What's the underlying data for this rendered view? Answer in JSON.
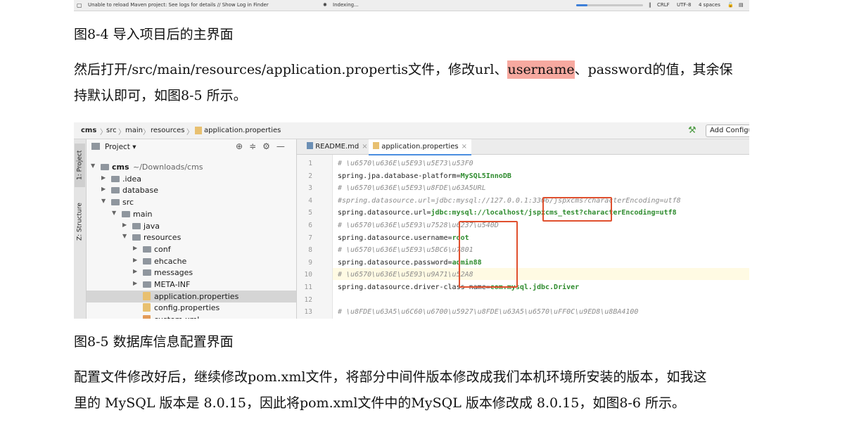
{
  "statusbar": {
    "message": "Unable to reload Maven project: See logs for details // Show Log in Finder",
    "indexing": "Indexing...",
    "progress": 0.17,
    "line_sep": "CRLF",
    "encoding": "UTF-8",
    "indent": "4 spaces"
  },
  "caption1": "图8-4 导入项目后的主界面",
  "para1": {
    "before": "然后打开/src/main/resources/application.propertis文件，修改url、",
    "highlight": "username",
    "after": "、password的值，其余保",
    "line2": "持默认即可，如图8-5 所示。",
    "highlight_color": "#f7a9a0"
  },
  "ide": {
    "breadcrumbs": [
      "cms",
      "src",
      "main",
      "resources",
      "application.properties"
    ],
    "add_config": "Add Configu",
    "side_tabs": [
      "1: Project",
      "Z: Structure"
    ],
    "project_header": "Project",
    "tree": [
      {
        "label": "cms",
        "sub": "~/Downloads/cms",
        "level": 0,
        "arrow": "▼",
        "kind": "folder",
        "bold": true
      },
      {
        "label": ".idea",
        "level": 1,
        "arrow": "▶",
        "kind": "folder"
      },
      {
        "label": "database",
        "level": 1,
        "arrow": "▶",
        "kind": "folder"
      },
      {
        "label": "src",
        "level": 1,
        "arrow": "▼",
        "kind": "folder"
      },
      {
        "label": "main",
        "level": 2,
        "arrow": "▼",
        "kind": "folder"
      },
      {
        "label": "java",
        "level": 3,
        "arrow": "▶",
        "kind": "folder"
      },
      {
        "label": "resources",
        "level": 3,
        "arrow": "▼",
        "kind": "folder"
      },
      {
        "label": "conf",
        "level": 4,
        "arrow": "▶",
        "kind": "folder"
      },
      {
        "label": "ehcache",
        "level": 4,
        "arrow": "▶",
        "kind": "folder"
      },
      {
        "label": "messages",
        "level": 4,
        "arrow": "▶",
        "kind": "folder"
      },
      {
        "label": "META-INF",
        "level": 4,
        "arrow": "▶",
        "kind": "folder"
      },
      {
        "label": "application.properties",
        "level": 4,
        "arrow": "",
        "kind": "file",
        "selected": true
      },
      {
        "label": "config.properties",
        "level": 4,
        "arrow": "",
        "kind": "file"
      },
      {
        "label": "custom.xml",
        "level": 4,
        "arrow": "",
        "kind": "xml"
      }
    ],
    "tabs": [
      {
        "label": "README.md",
        "active": false
      },
      {
        "label": "application.properties",
        "active": true
      }
    ],
    "lines": [
      {
        "n": "1",
        "key": "# \\u6570\\u636E\\u5E93\\u5E73\\u53F0",
        "val": "",
        "comment": true
      },
      {
        "n": "2",
        "key": "spring.jpa.database-platform=",
        "val": "MySQL5InnoDB",
        "comment": false
      },
      {
        "n": "3",
        "key": "# \\u6570\\u636E\\u5E93\\u8FDE\\u63A5URL",
        "val": "",
        "comment": true
      },
      {
        "n": "4",
        "key": "#spring.datasource.url=jdbc:mysql://127.0.0.1:3306/jspxcms?characterEncoding=utf8",
        "val": "",
        "comment": true
      },
      {
        "n": "5",
        "key": "spring.datasource.url=",
        "val": "jdbc:mysql://localhost/jspxcms_test?characterEncoding=utf8",
        "comment": false
      },
      {
        "n": "6",
        "key": "# \\u6570\\u636E\\u5E93\\u7528\\u6237\\u540D",
        "val": "",
        "comment": true
      },
      {
        "n": "7",
        "key": "spring.datasource.username=",
        "val": "root",
        "comment": false
      },
      {
        "n": "8",
        "key": "# \\u6570\\u636E\\u5E93\\u5BC6\\u7801",
        "val": "",
        "comment": true
      },
      {
        "n": "9",
        "key": "spring.datasource.password=",
        "val": "admin88",
        "comment": false
      },
      {
        "n": "10",
        "key": "# \\u6570\\u636E\\u5E93\\u9A71\\u52A8",
        "val": "",
        "comment": true
      },
      {
        "n": "11",
        "key": "spring.datasource.driver-class-name=",
        "val": "com.mysql.jdbc.Driver",
        "comment": false
      },
      {
        "n": "12",
        "key": "",
        "val": "",
        "comment": false
      },
      {
        "n": "13",
        "key": "# \\u8FDE\\u63A5\\u6C60\\u6700\\u5927\\u8FDE\\u63A5\\u6570\\uFF0C\\u9ED8\\u8BA4100",
        "val": "",
        "comment": true
      }
    ],
    "annotation_color": "#e0502e"
  },
  "caption2": "图8-5 数据库信息配置界面",
  "para2": {
    "line1": "配置文件修改好后，继续修改pom.xml文件，将部分中间件版本修改成我们本机环境所安装的版本，如我这",
    "line2": "里的 MySQL 版本是 8.0.15，因此将pom.xml文件中的MySQL 版本修改成 8.0.15，如图8-6 所示。"
  }
}
